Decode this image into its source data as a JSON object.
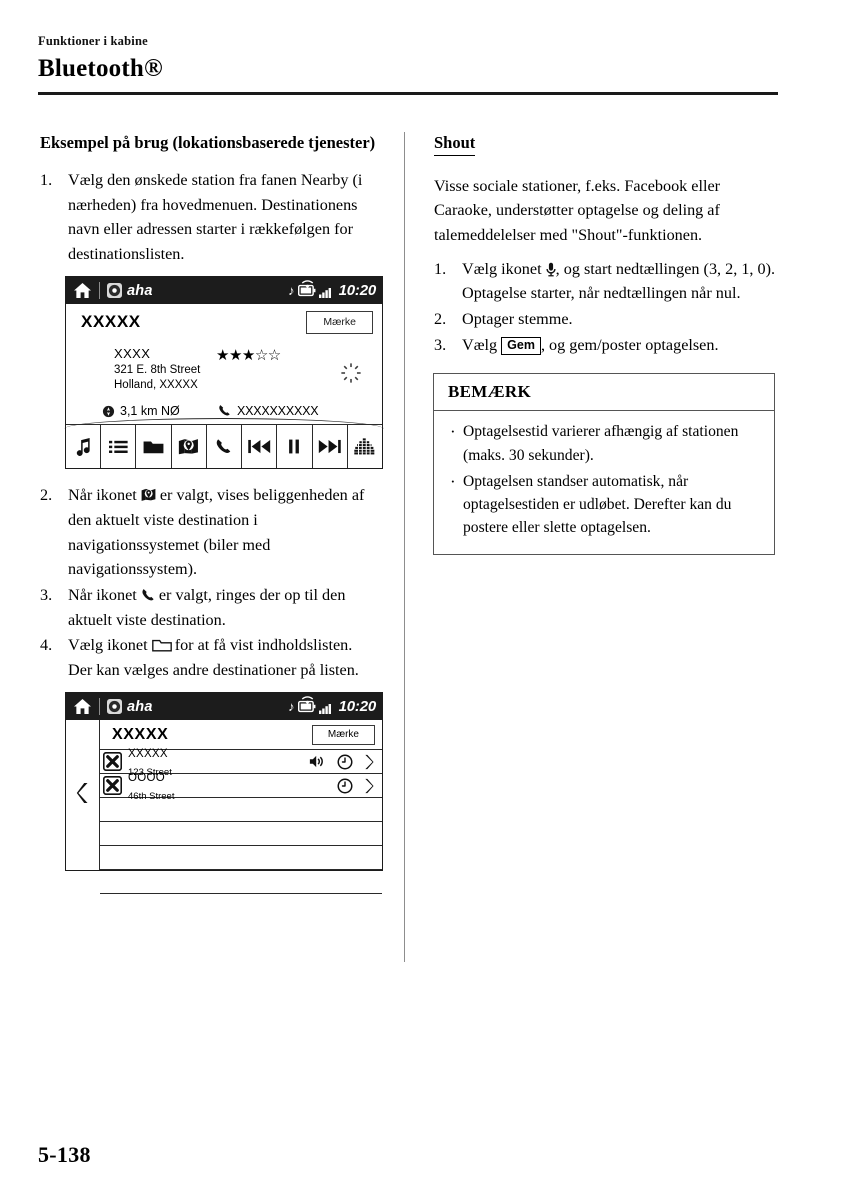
{
  "header": {
    "eyebrow": "Funktioner i kabine",
    "title": "Bluetooth®"
  },
  "left_column": {
    "section_title": "Eksempel på brug (lokationsbaserede tjenester)",
    "steps": [
      {
        "num": "1.",
        "text": "Vælg den ønskede station fra fanen Nearby (i nærheden) fra hovedmenuen. Destinationens navn eller adressen starter i rækkefølgen for destinationslisten."
      },
      {
        "num": "2.",
        "pre": "Når ikonet",
        "icon": "map-pin-icon",
        "post": "er valgt, vises beliggenheden af den aktuelt viste destination i navigationssystemet (biler med navigationssystem)."
      },
      {
        "num": "3.",
        "pre": "Når ikonet",
        "icon": "phone-icon",
        "post": "er valgt, ringes der op til den aktuelt viste destination."
      },
      {
        "num": "4.",
        "pre": "Vælg ikonet",
        "icon": "folder-icon",
        "post": "for at få vist indholdslisten.",
        "extra": "Der kan vælges andre destinationer på listen."
      }
    ]
  },
  "right_column": {
    "section_title": "Shout",
    "intro": "Visse sociale stationer, f.eks. Facebook eller Caraoke, understøtter optagelse og deling af talemeddelelser med \"Shout\"-funktionen.",
    "steps": [
      {
        "num": "1.",
        "pre": "Vælg ikonet",
        "icon": "microphone-icon",
        "post": ", og start nedtællingen (3, 2, 1, 0). Optagelse starter, når nedtællingen når nul."
      },
      {
        "num": "2.",
        "pre": "Optager stemme.",
        "icon": null,
        "post": ""
      },
      {
        "num": "3.",
        "pre": "Vælg",
        "key": "Gem",
        "post": ", og gem/poster optagelsen."
      }
    ],
    "note_box": {
      "heading": "BEMÆRK",
      "items": [
        "Optagelsestid varierer afhængig af stationen (maks. 30 sekunder).",
        "Optagelsen standser automatisk, når optagelsestiden er udløbet. Derefter kan du postere eller slette optagelsen."
      ]
    }
  },
  "screen_one": {
    "status_bar": {
      "home_icon": "home-icon",
      "app_icon": "aha-disc-icon",
      "app_name": "aha",
      "music_icon": "music-note-icon",
      "battery_icon": "battery-icon",
      "wifi_icon": "wifi-icon",
      "signal_icon": "signal-bars-icon",
      "clock": "10:20"
    },
    "station_name": "XXXXX",
    "brand_button": "Mærke",
    "destination": {
      "name": "XXXX",
      "address_line1": "321 E. 8th Street",
      "address_line2": "Holland, XXXXX"
    },
    "rating": {
      "filled": 3,
      "total": 5
    },
    "spinner_icon": "loading-spinner-icon",
    "distance": {
      "icon": "compass-icon",
      "value": "3,1 km NØ"
    },
    "phone": {
      "icon": "phone-icon",
      "value": "XXXXXXXXXX"
    },
    "toolbar": [
      {
        "name": "music-note-icon",
        "label": "Musik"
      },
      {
        "name": "list-icon",
        "label": "Liste"
      },
      {
        "name": "folder-icon",
        "label": "Mappe"
      },
      {
        "name": "map-pin-icon",
        "label": "Kort"
      },
      {
        "name": "phone-icon",
        "label": "Opkald"
      },
      {
        "name": "previous-track-icon",
        "label": "Forrige"
      },
      {
        "name": "pause-icon",
        "label": "Pause"
      },
      {
        "name": "next-track-icon",
        "label": "Næste"
      },
      {
        "name": "equalizer-icon",
        "label": "Equalizer"
      }
    ]
  },
  "screen_two": {
    "status_bar": {
      "home_icon": "home-icon",
      "app_icon": "aha-disc-icon",
      "app_name": "aha",
      "music_icon": "music-note-icon",
      "battery_icon": "battery-icon",
      "wifi_icon": "wifi-icon",
      "signal_icon": "signal-bars-icon",
      "clock": "10:20"
    },
    "back_icon": "back-chevron-icon",
    "station_name": "XXXXX",
    "brand_button": "Mærke",
    "rows": [
      {
        "icon": "x-mark-icon",
        "title": "XXXXX",
        "subtitle": "123 Street",
        "speaker": true,
        "clock": true,
        "chevron": true
      },
      {
        "icon": "x-mark-icon",
        "title": "OOOO",
        "subtitle": "46th Street",
        "speaker": false,
        "clock": true,
        "chevron": true
      }
    ],
    "empty_rows": 4
  },
  "footer": {
    "page_number": "5-138"
  },
  "colors": {
    "status_bar_bg": "#1c1c1c",
    "text": "#000000",
    "rule": "#1a1a1a",
    "note_border": "#555555"
  }
}
